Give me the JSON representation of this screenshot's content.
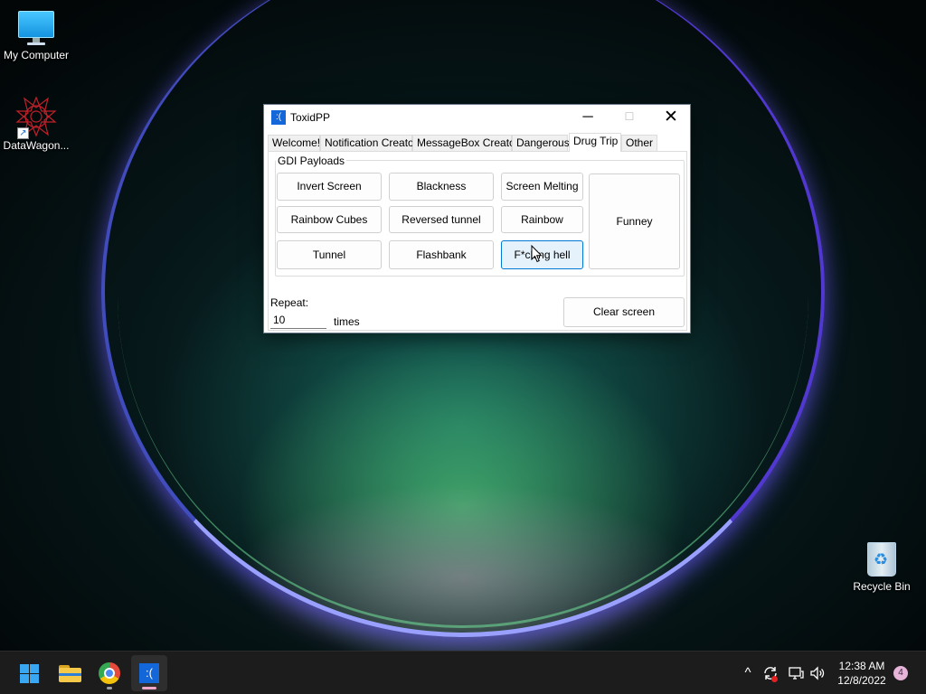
{
  "desktop": {
    "icons": [
      {
        "label": "My Computer",
        "icon": "monitor-icon"
      },
      {
        "label": "DataWagon...",
        "icon": "datawagon-shortcut-icon"
      },
      {
        "label": "Recycle Bin",
        "icon": "recycle-bin-icon"
      }
    ]
  },
  "window": {
    "title": "ToxidPP",
    "app_icon_glyph": ":(",
    "controls": {
      "minimize": "─",
      "maximize": "☐",
      "close": "✕"
    },
    "tabs": [
      {
        "label": "Welcome!"
      },
      {
        "label": "Notification Creator"
      },
      {
        "label": "MessageBox Creator"
      },
      {
        "label": "Dangerous"
      },
      {
        "label": "Drug Trip",
        "active": true
      },
      {
        "label": "Other"
      }
    ],
    "group_label": "GDI Payloads",
    "payload_buttons": [
      {
        "label": "Invert Screen"
      },
      {
        "label": "Blackness"
      },
      {
        "label": "Screen Melting"
      },
      {
        "label": "Rainbow Cubes"
      },
      {
        "label": "Reversed tunnel"
      },
      {
        "label": "Rainbow"
      },
      {
        "label": "Tunnel"
      },
      {
        "label": "Flashbank"
      },
      {
        "label": "F*cking hell",
        "hovered": true
      },
      {
        "label": "Funney"
      }
    ],
    "repeat_label": "Repeat:",
    "repeat_value": "10",
    "times_label": "times",
    "clear_button": "Clear screen"
  },
  "taskbar": {
    "apps": [
      {
        "name": "start-button",
        "icon": "windows-logo-icon"
      },
      {
        "name": "file-explorer",
        "icon": "folder-icon"
      },
      {
        "name": "chrome",
        "icon": "chrome-icon"
      },
      {
        "name": "toxidpp",
        "icon": "toxidpp-icon",
        "glyph": ":(",
        "active": true
      }
    ],
    "tray": {
      "chevron": "^",
      "time": "12:38 AM",
      "date": "12/8/2022",
      "notification_count": "4"
    }
  },
  "colors": {
    "accent": "#0078d4",
    "app_icon": "#1367d8",
    "taskbar": "#1c1c1c",
    "hover_button": "#e5f1fb"
  }
}
